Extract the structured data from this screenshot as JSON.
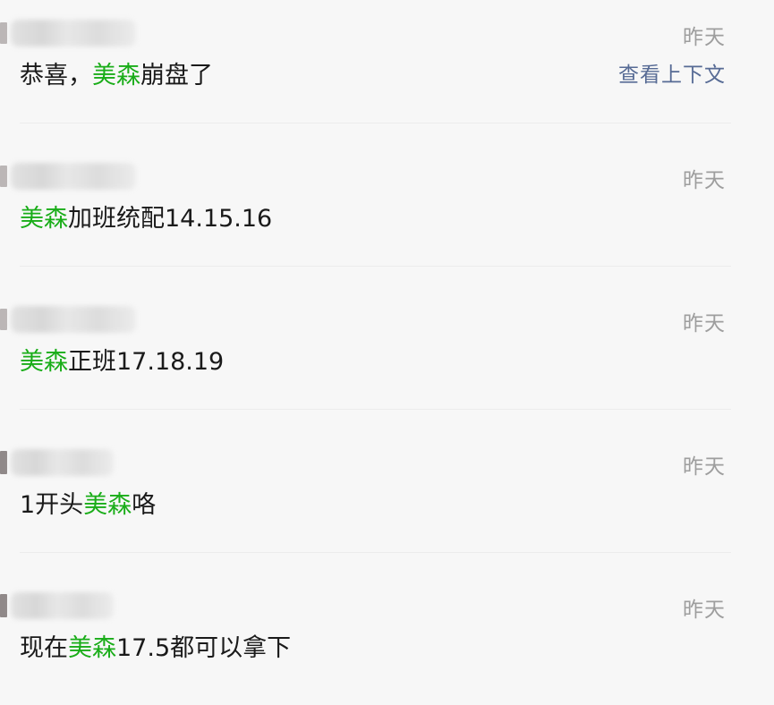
{
  "results": [
    {
      "time": "昨天",
      "context_link": "查看上下文",
      "segments": [
        {
          "text": "恭喜，",
          "highlight": false
        },
        {
          "text": "美森",
          "highlight": true
        },
        {
          "text": "崩盘了",
          "highlight": false
        }
      ]
    },
    {
      "time": "昨天",
      "segments": [
        {
          "text": "美森",
          "highlight": true
        },
        {
          "text": "加班统配14.15.16",
          "highlight": false
        }
      ]
    },
    {
      "time": "昨天",
      "segments": [
        {
          "text": "美森",
          "highlight": true
        },
        {
          "text": "正班17.18.19",
          "highlight": false
        }
      ]
    },
    {
      "time": "昨天",
      "segments": [
        {
          "text": "1开头",
          "highlight": false
        },
        {
          "text": "美森",
          "highlight": true
        },
        {
          "text": "咯",
          "highlight": false
        }
      ]
    },
    {
      "time": "昨天",
      "segments": [
        {
          "text": "现在",
          "highlight": false
        },
        {
          "text": "美森",
          "highlight": true
        },
        {
          "text": "17.5都可以拿下",
          "highlight": false
        }
      ]
    }
  ],
  "colors": {
    "highlight": "#1aad19",
    "link": "#576b95",
    "time": "#9e9e9e",
    "text": "#1a1a1a",
    "background": "#f7f7f7"
  }
}
